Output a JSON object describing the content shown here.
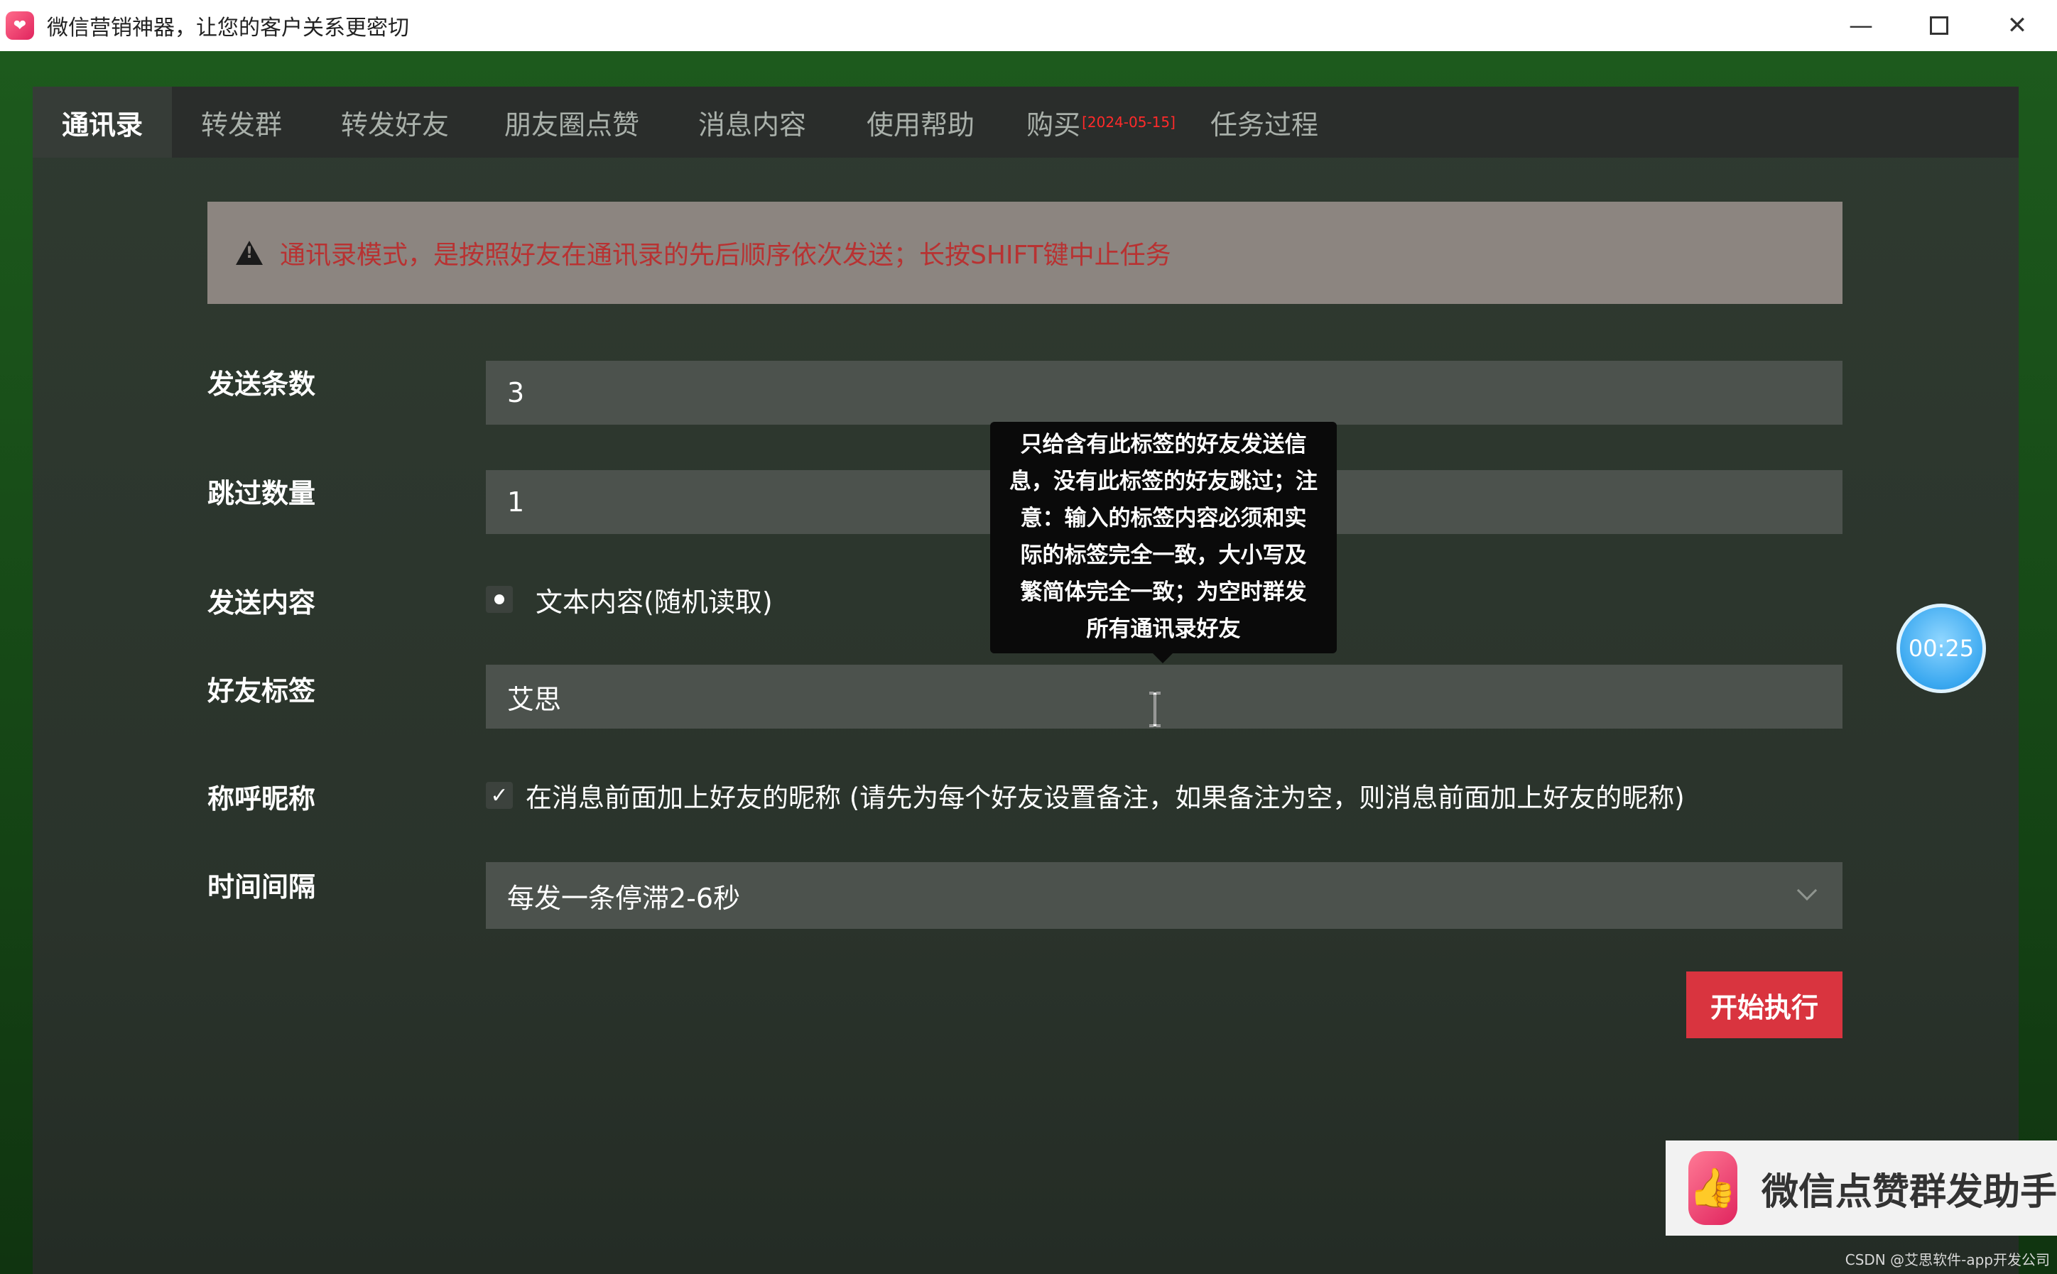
{
  "window": {
    "title": "微信营销神器，让您的客户关系更密切",
    "minimize_glyph": "—",
    "close_glyph": "✕"
  },
  "tabs": [
    {
      "label": "通讯录",
      "active": true
    },
    {
      "label": "转发群",
      "active": false
    },
    {
      "label": "转发好友",
      "active": false
    },
    {
      "label": "朋友圈点赞",
      "active": false
    },
    {
      "label": "消息内容",
      "active": false
    },
    {
      "label": "使用帮助",
      "active": false
    },
    {
      "label": "购买",
      "date": "[2024-05-15]",
      "active": false
    },
    {
      "label": "任务过程",
      "active": false
    }
  ],
  "warning": {
    "text": "通讯录模式，是按照好友在通讯录的先后顺序依次发送；长按SHIFT键中止任务"
  },
  "form": {
    "send_count": {
      "label": "发送条数",
      "value": "3"
    },
    "skip_count": {
      "label": "跳过数量",
      "value": "1"
    },
    "send_content": {
      "label": "发送内容",
      "option": "文本内容(随机读取)",
      "selected": true
    },
    "friend_tag": {
      "label": "好友标签",
      "value": "艾思"
    },
    "nickname": {
      "label": "称呼昵称",
      "checked": true,
      "check_glyph": "✓",
      "text": "在消息前面加上好友的昵称 (请先为每个好友设置备注，如果备注为空，则消息前面加上好友的昵称)"
    },
    "interval": {
      "label": "时间间隔",
      "value": "每发一条停滞2-6秒"
    }
  },
  "start_button": {
    "label": "开始执行"
  },
  "tooltip": {
    "lines": [
      "只给含有此标签的好友发送信",
      "息，没有此标签的好友跳过；注",
      "意：输入的标签内容必须和实",
      "际的标签完全一致，大小写及",
      "繁简体完全一致；为空时群发",
      "所有通讯录好友"
    ]
  },
  "timer": {
    "value": "00:25"
  },
  "promo": {
    "text": "微信点赞群发助手"
  },
  "credit": {
    "text": "CSDN @艾思软件-app开发公司"
  },
  "colors": {
    "accent_red": "#d9343f",
    "warning_text": "#b83232",
    "tab_bg": "#2a2d2b",
    "panel_bg": "#2f3a30",
    "timer_blue": "#3aa8f0"
  },
  "icons": {
    "app": "wechat-marketing-app-icon",
    "warning": "warning-triangle-icon",
    "timer": "timer-bubble",
    "cursor": "text-cursor-icon",
    "dropdown": "chevron-down-icon"
  }
}
